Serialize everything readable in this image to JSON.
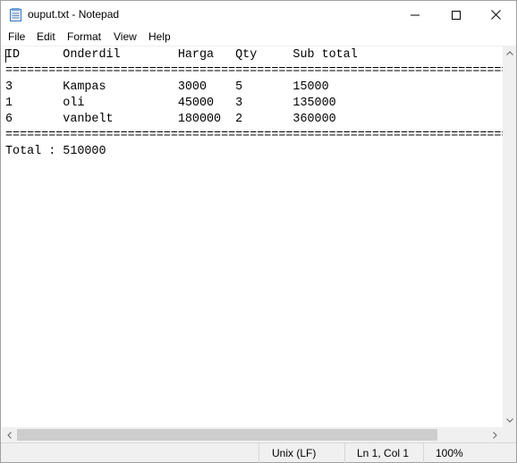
{
  "window": {
    "title": "ouput.txt - Notepad",
    "controls": {
      "minimize": "minimize",
      "maximize": "maximize",
      "close": "close"
    }
  },
  "menu": {
    "items": [
      {
        "label": "File"
      },
      {
        "label": "Edit"
      },
      {
        "label": "Format"
      },
      {
        "label": "View"
      },
      {
        "label": "Help"
      }
    ]
  },
  "document": {
    "lines": [
      "ID      Onderdil        Harga   Qty     Sub total",
      "======================================================================",
      "3       Kampas          3000    5       15000",
      "1       oli             45000   3       135000",
      "6       vanbelt         180000  2       360000",
      "======================================================================",
      "Total : 510000"
    ]
  },
  "status": {
    "line_ending": "Unix (LF)",
    "cursor": "Ln 1, Col 1",
    "zoom": "100%"
  },
  "colors": {
    "chrome": "#f0f0f0",
    "border": "#a0a0a0",
    "text": "#000000"
  }
}
